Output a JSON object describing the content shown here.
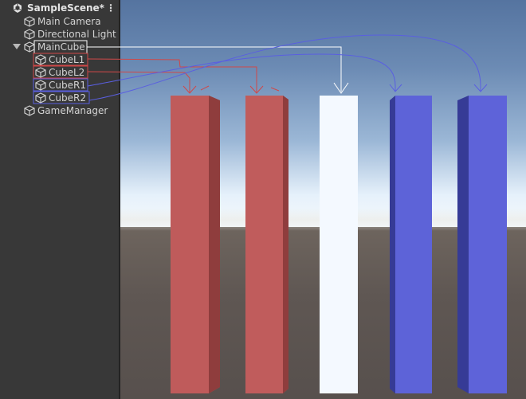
{
  "hierarchy": {
    "scene_name": "SampleScene*",
    "menu_glyph": "⋮",
    "items": [
      {
        "label": "Main Camera",
        "icon": "cube-icon"
      },
      {
        "label": "Directional Light",
        "icon": "cube-icon"
      },
      {
        "label": "MainCube",
        "icon": "cube-icon",
        "expanded": true
      },
      {
        "label": "CubeL1",
        "icon": "cube-icon"
      },
      {
        "label": "CubeL2",
        "icon": "cube-icon"
      },
      {
        "label": "CubeR1",
        "icon": "cube-icon"
      },
      {
        "label": "CubeR2",
        "icon": "cube-icon"
      },
      {
        "label": "GameManager",
        "icon": "cube-icon"
      }
    ]
  },
  "scene_view": {
    "colors": {
      "cube_left": "#c05c5c",
      "cube_center": "#ffffff",
      "cube_right": "#5d63d8",
      "link_white": "#ffffff",
      "link_red": "#d04848",
      "link_blue": "#5a5fe0"
    }
  }
}
